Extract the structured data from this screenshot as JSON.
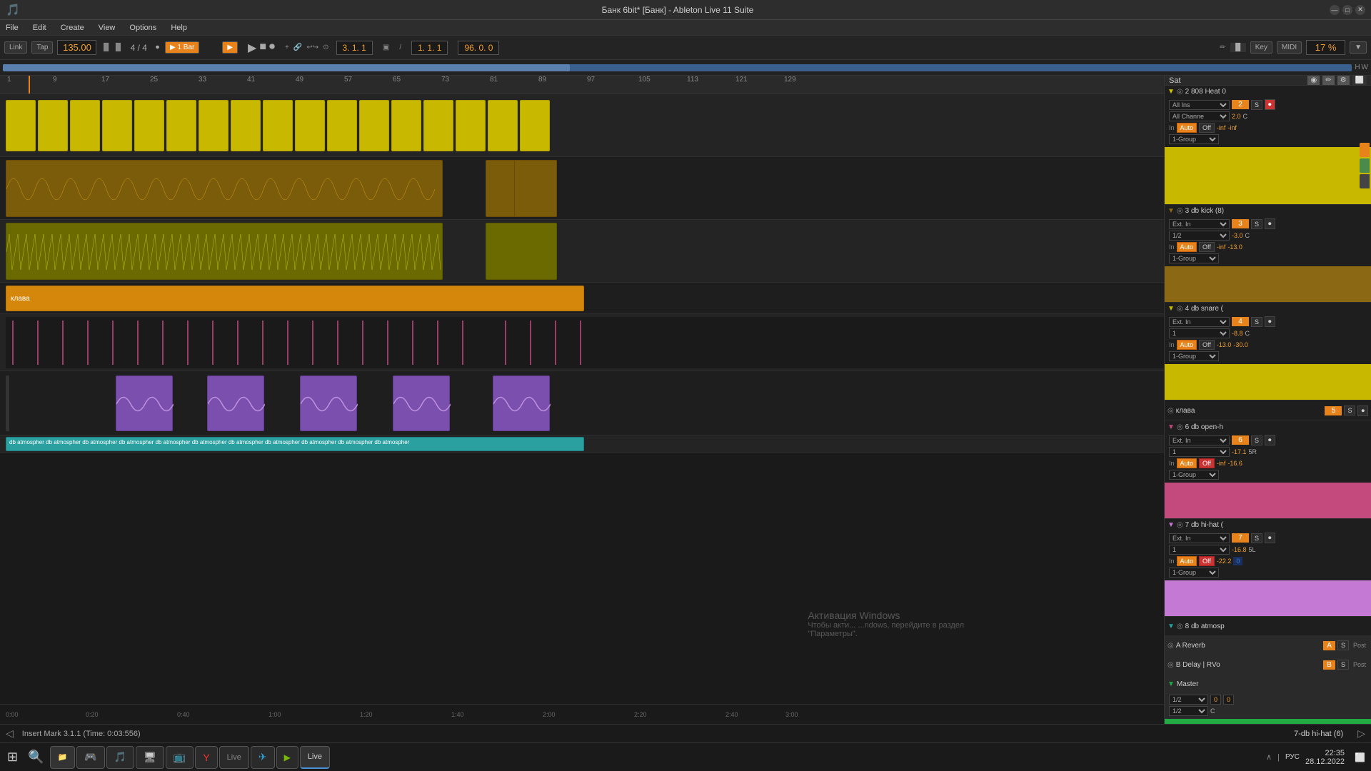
{
  "titlebar": {
    "title": "Банк 6bit* [Банк] - Ableton Live 11 Suite",
    "min_label": "—",
    "max_label": "□",
    "close_label": "✕"
  },
  "menubar": {
    "items": [
      "File",
      "Edit",
      "Create",
      "View",
      "Options",
      "Help"
    ]
  },
  "transport": {
    "link": "Link",
    "tap": "Tap",
    "bpm": "135.00",
    "time_sig": "4 / 4",
    "loop_btn": "1 Bar",
    "position": "3. 1. 1",
    "position2": "1. 1. 1",
    "tempo_display": "96. 0. 0",
    "key_btn": "Key",
    "midi_btn": "MIDI",
    "zoom": "17 %"
  },
  "timeline": {
    "marks": [
      "1",
      "9",
      "17",
      "25",
      "33",
      "41",
      "49",
      "57",
      "65",
      "73",
      "81",
      "89",
      "97",
      "105",
      "113",
      "121",
      "129"
    ]
  },
  "channels": [
    {
      "id": "ch1",
      "name": "2 808 Heat 0",
      "color": "#d4c400",
      "input": "All Ins",
      "input2": "All Chann",
      "monitor": "In",
      "auto": "Auto",
      "off": "Off",
      "volume": "-inf",
      "volume2": "-inf",
      "number": "2",
      "group": "1-Group",
      "pan": "C"
    },
    {
      "id": "ch2",
      "name": "3 db kick (8)",
      "color": "#8B6914",
      "input": "Ext. In",
      "input2": "1/2",
      "monitor": "In",
      "auto": "Auto",
      "off": "Off",
      "volume": "-inf",
      "volume2": "-13.0",
      "number": "3",
      "group": "1-Group",
      "pan": "C",
      "vol_main": "-3.0"
    },
    {
      "id": "ch3",
      "name": "4 db snare (",
      "color": "#d4c400",
      "input": "Ext. In",
      "input2": "1",
      "monitor": "In",
      "auto": "Auto",
      "off": "Off",
      "volume": "-13.0",
      "volume2": "-30.0",
      "number": "4",
      "group": "1-Group",
      "pan": "C",
      "vol_main": "-8.8"
    },
    {
      "id": "ch4",
      "name": "клава",
      "color": "#d4870a",
      "number": "5"
    },
    {
      "id": "ch5",
      "name": "6 db open-h",
      "color": "#c44a7e",
      "input": "Ext. In",
      "input2": "1",
      "monitor": "In",
      "auto": "Auto",
      "off": "Off",
      "volume": "-inf",
      "volume2": "-16.6",
      "number": "6",
      "group": "1-Group",
      "pan": "5R",
      "vol_main": "-17.1"
    },
    {
      "id": "ch6",
      "name": "7 db hi-hat (",
      "color": "#c479d4",
      "input": "Ext. In",
      "input2": "1",
      "monitor": "In",
      "auto": "Auto",
      "off": "Off",
      "volume": "-22.2",
      "volume2": "0",
      "number": "7",
      "group": "1-Group",
      "pan": "5L",
      "vol_main": "-16.8"
    },
    {
      "id": "ch7",
      "name": "8 db atmosp",
      "color": "#2aa0a0",
      "number": "8"
    },
    {
      "id": "ch8",
      "name": "A Reverb",
      "color": "#e8821a",
      "letter": "A"
    },
    {
      "id": "ch9",
      "name": "B Delay | RVo",
      "color": "#e8821a",
      "letter": "B"
    },
    {
      "id": "ch10",
      "name": "Master",
      "color": "#22aa44",
      "input1": "1/2",
      "input2": "1/2",
      "number": "0",
      "number2": "0",
      "pan": "C"
    }
  ],
  "statusbar": {
    "insert_mark": "Insert Mark 3.1.1 (Time: 0:03:556)",
    "track_name": "7-db hi-hat (6)"
  },
  "watermark": {
    "line1": "Активация Windows",
    "line2": "Чтобы акти... ...ndows, перейдите в раздел",
    "line3": "\"Параметры\"."
  },
  "taskbar": {
    "time": "22:35",
    "date": "28.12.2022",
    "lang": "РУС",
    "apps": [
      {
        "label": "⊞",
        "name": "start"
      },
      {
        "label": "🔍",
        "name": "search"
      },
      {
        "label": "📁",
        "name": "explorer"
      },
      {
        "label": "🎮",
        "name": "epic"
      },
      {
        "label": "🎵",
        "name": "steam"
      },
      {
        "label": "🖥",
        "name": "discord"
      },
      {
        "label": "📺",
        "name": "xbox"
      },
      {
        "label": "🦊",
        "name": "yandex"
      },
      {
        "label": "Live",
        "name": "live-taskbar"
      },
      {
        "label": "✈",
        "name": "telegram"
      },
      {
        "label": "🎮",
        "name": "nvidia"
      },
      {
        "label": "Live",
        "name": "ableton-active"
      }
    ]
  }
}
